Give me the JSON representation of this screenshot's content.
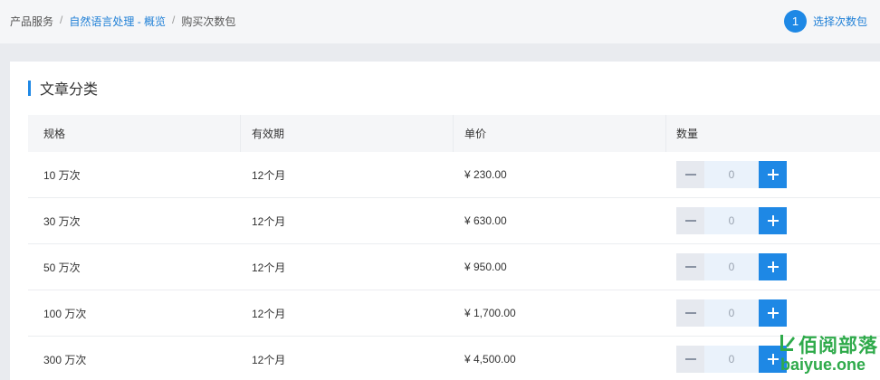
{
  "breadcrumb": {
    "items": [
      "产品服务",
      "自然语言处理 - 概览",
      "购买次数包"
    ],
    "separator": "/"
  },
  "step": {
    "number": "1",
    "label": "选择次数包"
  },
  "section": {
    "title": "文章分类"
  },
  "table": {
    "headers": [
      "规格",
      "有效期",
      "单价",
      "数量"
    ],
    "rows": [
      {
        "spec": "10 万次",
        "validity": "12个月",
        "price": "¥ 230.00",
        "qty": "0"
      },
      {
        "spec": "30 万次",
        "validity": "12个月",
        "price": "¥ 630.00",
        "qty": "0"
      },
      {
        "spec": "50 万次",
        "validity": "12个月",
        "price": "¥ 950.00",
        "qty": "0"
      },
      {
        "spec": "100 万次",
        "validity": "12个月",
        "price": "¥ 1,700.00",
        "qty": "0"
      },
      {
        "spec": "300 万次",
        "validity": "12个月",
        "price": "¥ 4,500.00",
        "qty": "0"
      }
    ]
  },
  "watermark": {
    "cn": "佰阅部落",
    "en": "baiyue.one"
  },
  "icons": {
    "minus": "minus-icon",
    "plus": "plus-icon",
    "logo": "leaf-logo-icon"
  },
  "colors": {
    "accent": "#1e88e5",
    "link": "#1e7fd6",
    "watermark": "#2eaa4a"
  }
}
